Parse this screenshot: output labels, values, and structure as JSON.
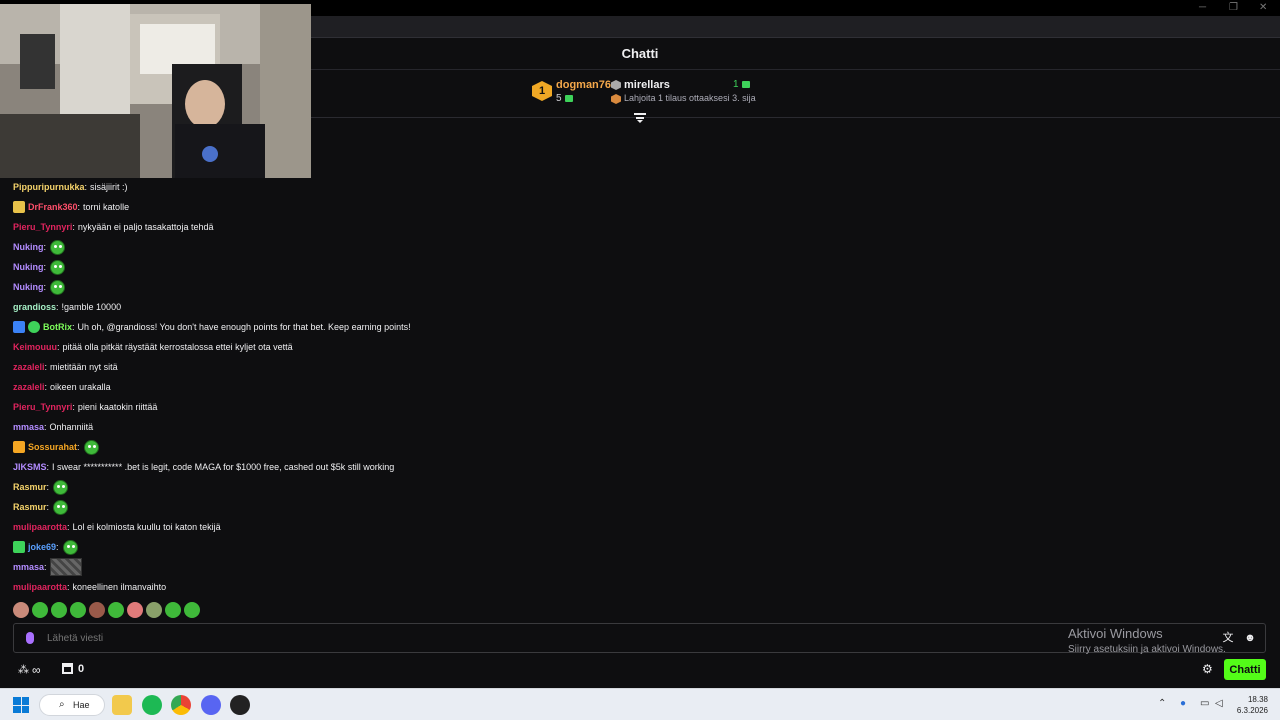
{
  "window": {
    "minimize": "─",
    "restore": "❐",
    "close": "✕"
  },
  "chat": {
    "title": "Chatti",
    "leaderboard": {
      "first": {
        "rank": "1",
        "name": "dogman76",
        "count": "5"
      },
      "second": {
        "name": "mirellars",
        "count": "1"
      },
      "hint": "Lahjoita 1 tilaus ottaaksesi 3. sija"
    },
    "messages": [
      {
        "user": "Pippuripurnukka",
        "color": "#f5d36b",
        "text": "sisäjiirit :)"
      },
      {
        "user": "DrFrank360",
        "color": "#ff4f6b",
        "text": "torni katolle",
        "badge": "#e8c24a"
      },
      {
        "user": "Pieru_Tynnyri",
        "color": "#e0245e",
        "text": "nykyään ei paljo tasakattoja tehdä"
      },
      {
        "user": "Nuking",
        "color": "#b38cff",
        "text": "",
        "emote": true
      },
      {
        "user": "Nuking",
        "color": "#b38cff",
        "text": "",
        "emote": true
      },
      {
        "user": "Nuking",
        "color": "#b38cff",
        "text": "",
        "emote": true
      },
      {
        "user": "grandioss",
        "color": "#a6f0c6",
        "text": "!gamble 10000"
      },
      {
        "user": "BotRix",
        "color": "#7cfc5a",
        "text": "Uh oh, @grandioss! You don't have enough points for that bet. Keep earning points!",
        "badge": "#3b82f6",
        "badge2": "#3ed25a"
      },
      {
        "user": "Keimouuu",
        "color": "#e0245e",
        "text": "pitää olla pitkät räystäät kerrostalossa ettei kyljet ota vettä"
      },
      {
        "user": "zazaleli",
        "color": "#e0245e",
        "text": "mietitään nyt sitä"
      },
      {
        "user": "zazaleli",
        "color": "#e0245e",
        "text": "oikeen urakalla"
      },
      {
        "user": "Pieru_Tynnyri",
        "color": "#e0245e",
        "text": "pieni kaatokin riittää"
      },
      {
        "user": "mmasa",
        "color": "#b38cff",
        "text": "Onhanniitä"
      },
      {
        "user": "Sossurahat",
        "color": "#f5a623",
        "text": "",
        "emote": true,
        "badge": "#f5a623"
      },
      {
        "user": "JIKSMS",
        "color": "#b38cff",
        "text": "I swear *********** .bet is legit, code MAGA for $1000 free, cashed out $5k still working"
      },
      {
        "user": "Rasmur",
        "color": "#f5d36b",
        "text": "",
        "emote": true
      },
      {
        "user": "Rasmur",
        "color": "#f5d36b",
        "text": "",
        "emote": true
      },
      {
        "user": "mulipaarotta",
        "color": "#e0245e",
        "text": "Lol ei kolmiosta kuullu toi katon tekijä"
      },
      {
        "user": "joke69",
        "color": "#5aa0ff",
        "text": "",
        "emote": true,
        "badge": "#3ed25a"
      },
      {
        "user": "mmasa",
        "color": "#b38cff",
        "text": "",
        "img": true
      },
      {
        "user": "mulipaarotta",
        "color": "#e0245e",
        "text": "koneellinen ilmanvaihto"
      }
    ],
    "input_placeholder": "Lähetä viesti",
    "watermark_title": "Aktivoi Windows",
    "watermark_sub": "Siirry asetuksiin ja aktivoi Windows.",
    "points": "∞",
    "store_count": "0",
    "send_label": "Chatti"
  },
  "taskbar": {
    "search": "Hae",
    "time": "18.38",
    "date": "6.3.2026"
  }
}
